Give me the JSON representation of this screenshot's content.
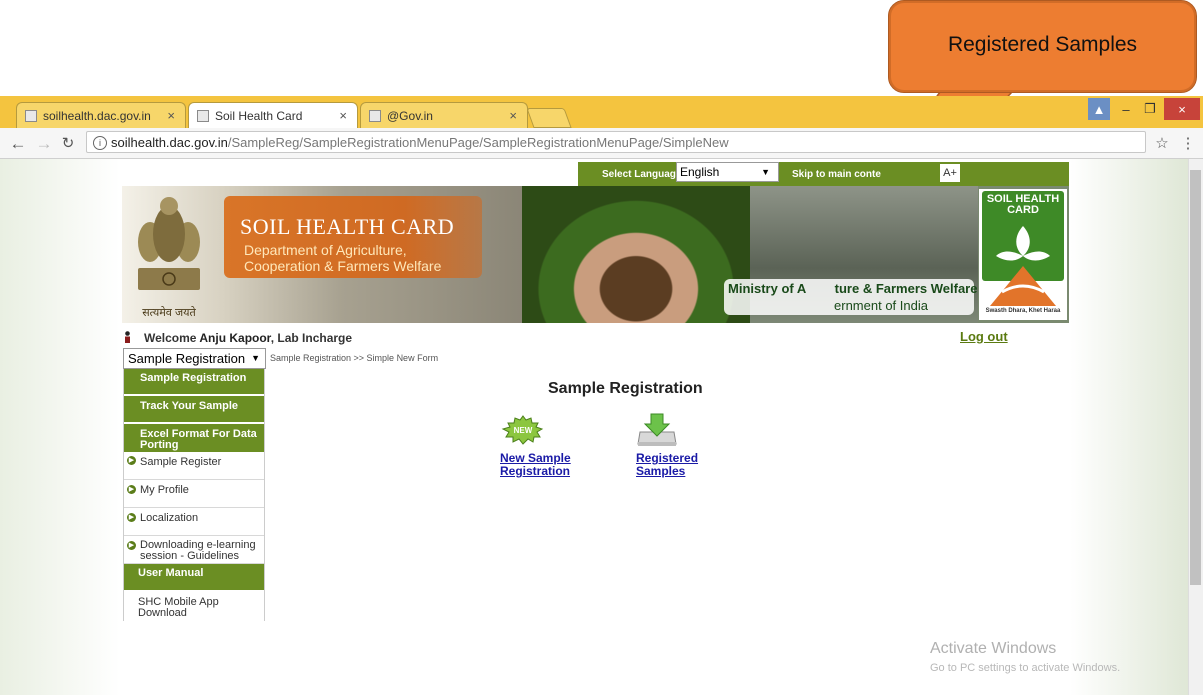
{
  "callout": {
    "text": "Registered Samples"
  },
  "browser": {
    "tabs": [
      {
        "label": "soilhealth.dac.gov.in",
        "close": "×"
      },
      {
        "label": "Soil Health Card",
        "close": "×"
      },
      {
        "label": "@Gov.in",
        "close": "×"
      }
    ],
    "url_host": "soilhealth.dac.gov.in",
    "url_path": "/SampleReg/SampleRegistrationMenuPage/SampleRegistrationMenuPage/SimpleNew",
    "window_controls": [
      "–",
      "❐",
      "×"
    ],
    "nav_icons": [
      "back-icon",
      "forward-icon",
      "reload-icon",
      "star-icon",
      "menu-icon"
    ]
  },
  "topbar": {
    "select_language_label": "Select Language",
    "language_value": "English",
    "skip_label": "Skip to main conte",
    "font_label": "A+"
  },
  "banner": {
    "title": "SOIL HEALTH CARD",
    "subtitle_line1": "Department of Agriculture,",
    "subtitle_line2": "Cooperation & Farmers Welfare",
    "ministry_line1": "Ministry of A        ture & Farmers Welfare",
    "ministry_line2": "ernment of India",
    "emblem_motto": "सत्यमेव जयते",
    "logo_title": "SOIL HEALTH CARD",
    "logo_tagline": "Swasth Dhara, Khet Haraa"
  },
  "welcome": {
    "prefix": "Welcome",
    "name": "Anju Kapoor",
    "role": ", Lab Incharge",
    "logout": "Log out"
  },
  "sidebar": {
    "select_value": "Sample Registration",
    "breadcrumb": "Sample Registration >> Simple New Form",
    "items": [
      {
        "label": "Sample Registration"
      },
      {
        "label": "Track Your Sample"
      },
      {
        "label": "Excel Format For Data Porting"
      },
      {
        "label": "Sample Register"
      },
      {
        "label": "My Profile"
      },
      {
        "label": "Localization"
      },
      {
        "label": "Downloading e-learning session - Guidelines"
      },
      {
        "label": "User Manual"
      },
      {
        "label": "SHC Mobile App Download"
      }
    ]
  },
  "main": {
    "heading": "Sample Registration",
    "new_badge": "NEW",
    "link_new_line1": "New Sample",
    "link_new_line2": "Registration",
    "link_reg_line1": "Registered",
    "link_reg_line2": "Samples"
  },
  "watermark": {
    "line1": "Activate Windows",
    "line2": "Go to PC settings to activate Windows."
  }
}
